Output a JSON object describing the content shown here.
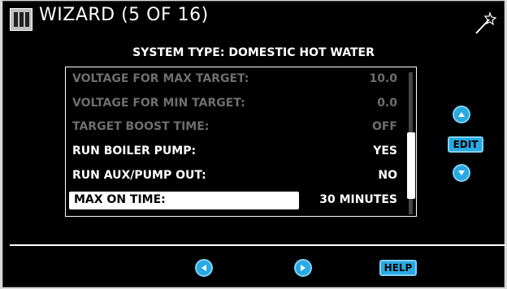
{
  "header": {
    "title": "WIZARD (5 OF 16)"
  },
  "system_type": "SYSTEM TYPE: DOMESTIC HOT WATER",
  "rows": [
    {
      "label": "VOLTAGE FOR MAX TARGET:",
      "value": "10.0"
    },
    {
      "label": "VOLTAGE FOR MIN TARGET:",
      "value": "0.0"
    },
    {
      "label": "TARGET BOOST TIME:",
      "value": "OFF"
    },
    {
      "label": "RUN BOILER PUMP:",
      "value": "YES"
    },
    {
      "label": "RUN AUX/PUMP OUT:",
      "value": "NO"
    },
    {
      "label": "MAX ON TIME:",
      "value": "30 MINUTES"
    }
  ],
  "buttons": {
    "edit": "EDIT",
    "help": "HELP"
  },
  "icons": {
    "logo": "brand-logo-icon",
    "wand": "wizard-wand-icon",
    "up": "up-arrow-icon",
    "down": "down-arrow-icon",
    "left": "left-arrow-icon",
    "right": "right-arrow-icon"
  },
  "colors": {
    "accent": "#29a9e1",
    "background": "#000000",
    "dim_text": "#6e6e6e"
  }
}
